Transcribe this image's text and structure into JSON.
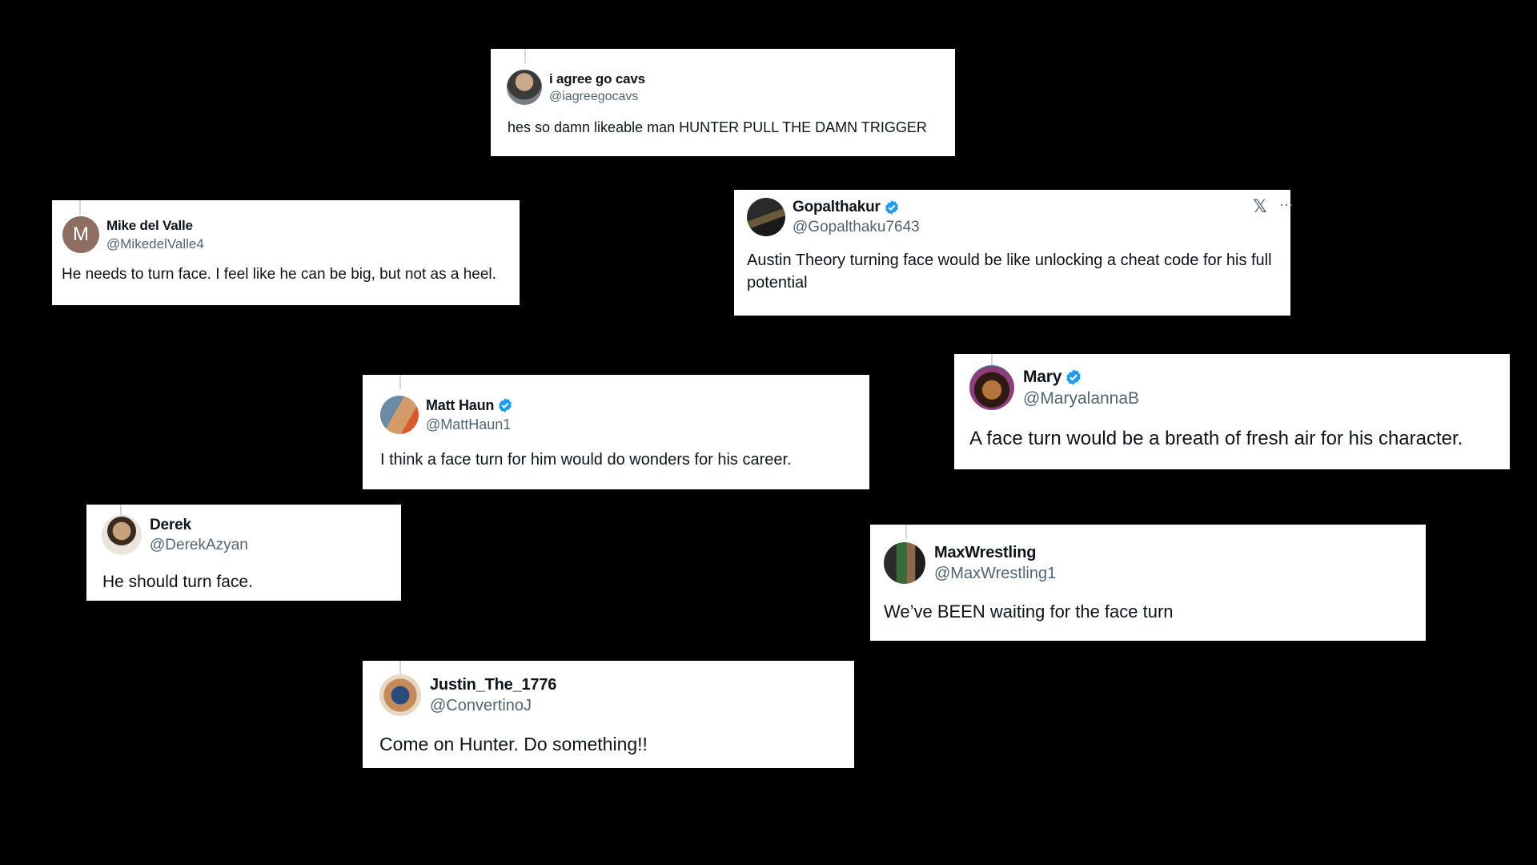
{
  "colors": {
    "background": "#000000",
    "card": "#ffffff",
    "verified": "#1d9bf0",
    "handle": "#536471"
  },
  "tweets": [
    {
      "name": "i agree go cavs",
      "handle": "@iagreegocavs",
      "text": "hes so damn likeable man HUNTER PULL THE DAMN TRIGGER",
      "verified": false,
      "avatar_icon": "profile-photo"
    },
    {
      "name": "Mike del Valle",
      "handle": "@MikedelValle4",
      "text": "He needs to turn face. I feel like he can be big, but not as a heel.",
      "verified": false,
      "avatar_initial": "M"
    },
    {
      "name": "Gopalthakur",
      "handle": "@Gopalthaku7643",
      "text": "Austin Theory turning face would be like unlocking a cheat code for his full potential",
      "verified": true,
      "avatar_icon": "profile-photo"
    },
    {
      "name": "Mary",
      "handle": "@MaryalannaB",
      "text": "A face turn would be a breath of fresh air for his character.",
      "verified": true,
      "avatar_icon": "profile-photo"
    },
    {
      "name": "Matt Haun",
      "handle": "@MattHaun1",
      "text": "I think a face turn for him would do wonders for his career.",
      "verified": true,
      "avatar_icon": "profile-photo"
    },
    {
      "name": "Derek",
      "handle": "@DerekAzyan",
      "text": "He should turn face.",
      "verified": false,
      "avatar_icon": "profile-photo"
    },
    {
      "name": "MaxWrestling",
      "handle": "@MaxWrestling1",
      "text": "We’ve BEEN waiting for the face turn",
      "verified": false,
      "avatar_icon": "profile-photo"
    },
    {
      "name": "Justin_The_1776",
      "handle": "@ConvertinoJ",
      "text": "Come on Hunter. Do something!!",
      "verified": false,
      "avatar_icon": "profile-photo"
    }
  ]
}
